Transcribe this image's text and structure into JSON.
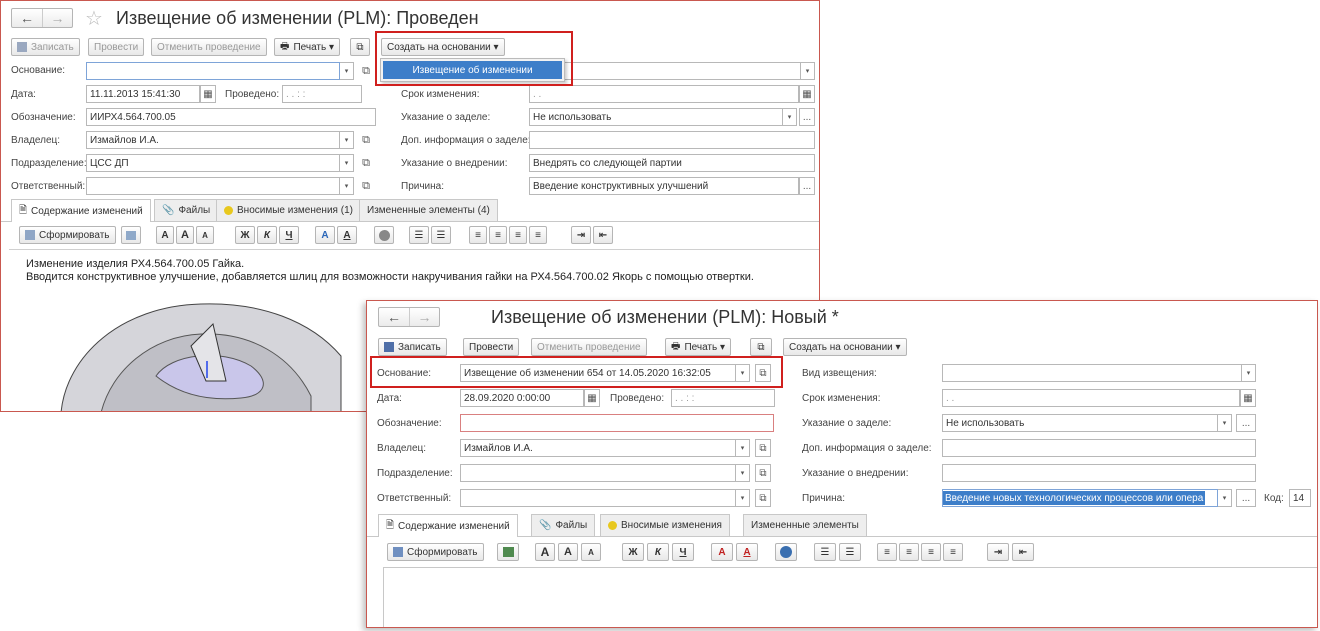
{
  "w1": {
    "title": "Извещение об изменении (PLM): Проведен",
    "back": "←",
    "forward": "→",
    "star": "☆",
    "buttons": {
      "write": "Записать",
      "post": "Провести",
      "unpost": "Отменить проведение",
      "print": "Печать",
      "create": "Создать на основании"
    },
    "menu_item": "Извещение об изменении",
    "labels": {
      "osnovanie": "Основание:",
      "date": "Дата:",
      "provedeno": "Проведено:",
      "oboznachenie": "Обозначение:",
      "vladelec": "Владелец:",
      "podrazdelenie": "Подразделение:",
      "otvetstvenny": "Ответственный:",
      "srok": "Срок изменения:",
      "ukazanie_zadel": "Указание о заделе:",
      "dop_info": "Доп. информация о заделе:",
      "ukazanie_vnedr": "Указание о внедрении:",
      "prichina": "Причина:"
    },
    "values": {
      "osnovanie": "",
      "date": "11.11.2013 15:41:30",
      "provedeno": " .  .      :  :",
      "oboznachenie": "ИИРХ4.564.700.05",
      "vladelec": "Измайлов И.А.",
      "podrazdelenie": "ЦСС ДП",
      "otvetstvenny": "",
      "vid_partial": "ие",
      "srok": " .  .",
      "ukazanie_zadel": "Не использовать",
      "dop_info": "",
      "ukazanie_vnedr": "Внедрять со следующей партии",
      "prichina": "Введение конструктивных улучшений"
    },
    "tabs": [
      "Содержание изменений",
      "Файлы",
      "Вносимые изменения (1)",
      "Измененные элементы (4)"
    ],
    "form_btn": "Сформировать",
    "content_lines": [
      "Изменение изделия  РХ4.564.700.05 Гайка.",
      "Вводится конструктивное улучшение, добавляется шлиц для возможности накручивания гайки на  РХ4.564.700.02 Якорь с помощью отвертки."
    ]
  },
  "w2": {
    "title": "Извещение об изменении (PLM): Новый *",
    "back": "←",
    "forward": "→",
    "buttons": {
      "write": "Записать",
      "post": "Провести",
      "unpost": "Отменить проведение",
      "print": "Печать",
      "create": "Создать на основании"
    },
    "labels": {
      "osnovanie": "Основание:",
      "date": "Дата:",
      "provedeno": "Проведено:",
      "oboznachenie": "Обозначение:",
      "vladelec": "Владелец:",
      "podrazdelenie": "Подразделение:",
      "otvetstvenny": "Ответственный:",
      "vid": "Вид извещения:",
      "srok": "Срок изменения:",
      "ukazanie_zadel": "Указание о заделе:",
      "dop_info": "Доп. информация о заделе:",
      "ukazanie_vnedr": "Указание о внедрении:",
      "prichina": "Причина:",
      "kod": "Код:"
    },
    "values": {
      "osnovanie": "Извещение об изменении 654 от 14.05.2020 16:32:05",
      "date": "28.09.2020  0:00:00",
      "provedeno": " .  .      :  :",
      "oboznachenie": "",
      "vladelec": "Измайлов И.А.",
      "podrazdelenie": "",
      "otvetstvenny": "",
      "vid": "",
      "srok": " .  .",
      "ukazanie_zadel": "Не использовать",
      "dop_info": "",
      "ukazanie_vnedr": "",
      "prichina": "Введение новых технологических процессов или опера",
      "kod": "14"
    },
    "tabs": [
      "Содержание изменений",
      "Файлы",
      "Вносимые изменения",
      "Измененные элементы"
    ],
    "form_btn": "Сформировать"
  },
  "toolbar_glyphs": {
    "font_a": "A",
    "font_up": "A",
    "font_down": "A",
    "bold": "Ж",
    "italic": "К",
    "underline": "Ч",
    "fill": "A",
    "color": "A"
  },
  "glyphs": {
    "dropdown": "▾",
    "link": "⧉",
    "calendar": "▦",
    "ellipsis": "..."
  }
}
